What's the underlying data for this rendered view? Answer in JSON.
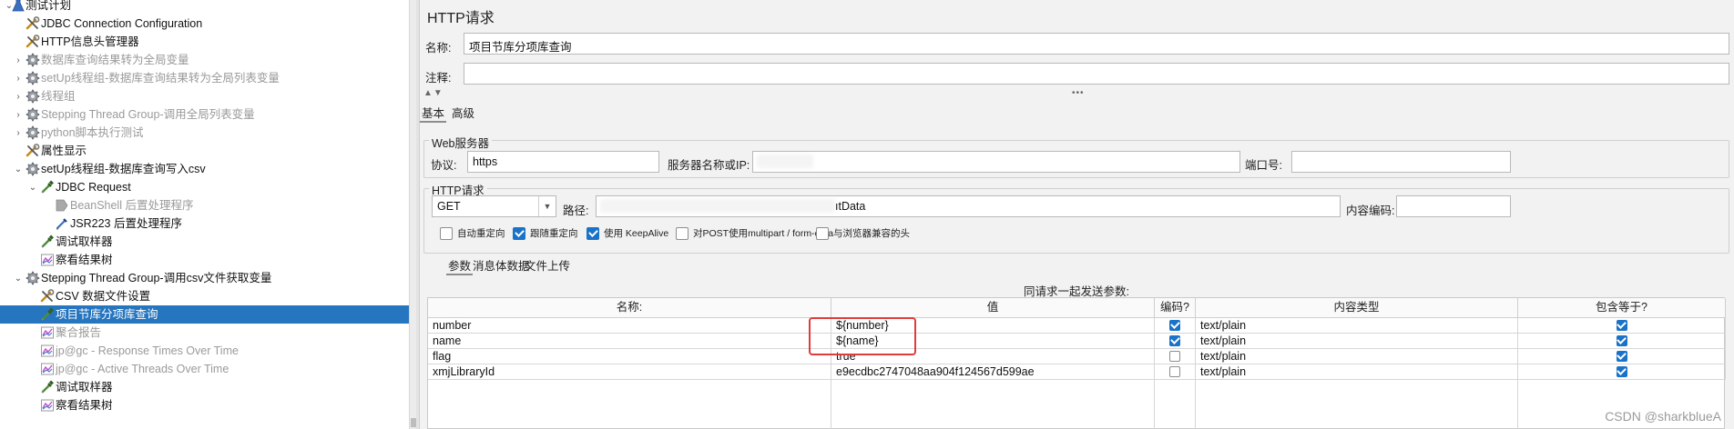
{
  "tree": {
    "items": [
      {
        "label": "测试计划",
        "icon": "test-plan-icon",
        "toggle": "expanded"
      },
      {
        "label": "JDBC Connection Configuration",
        "icon": "config-wrench-icon",
        "toggle": ""
      },
      {
        "label": "HTTP信息头管理器",
        "icon": "config-wrench-icon",
        "toggle": ""
      },
      {
        "label": "数据库查询结果转为全局变量",
        "icon": "thread-group-gear-icon",
        "toggle": "collapsed"
      },
      {
        "label": "setUp线程组-数据库查询结果转为全局列表变量",
        "icon": "thread-group-gear-icon",
        "toggle": "collapsed"
      },
      {
        "label": "线程组",
        "icon": "thread-group-gear-icon",
        "toggle": "collapsed"
      },
      {
        "label": "Stepping Thread Group-调用全局列表变量",
        "icon": "thread-group-gear-icon",
        "toggle": "collapsed"
      },
      {
        "label": "python脚本执行测试",
        "icon": "thread-group-gear-icon",
        "toggle": "collapsed"
      },
      {
        "label": "属性显示",
        "icon": "config-wrench-icon",
        "toggle": ""
      },
      {
        "label": "setUp线程组-数据库查询写入csv",
        "icon": "thread-group-gear-icon",
        "toggle": "expanded"
      },
      {
        "label": "JDBC Request",
        "icon": "sampler-pipette-icon",
        "toggle": "expanded"
      },
      {
        "label": "BeanShell 后置处理程序",
        "icon": "postprocessor-icon",
        "toggle": ""
      },
      {
        "label": "JSR223 后置处理程序",
        "icon": "script-icon",
        "toggle": ""
      },
      {
        "label": "调试取样器",
        "icon": "sampler-pipette-icon",
        "toggle": ""
      },
      {
        "label": "察看结果树",
        "icon": "listener-chart-icon",
        "toggle": ""
      },
      {
        "label": "Stepping Thread Group-调用csv文件获取变量",
        "icon": "thread-group-gear-icon",
        "toggle": "expanded"
      },
      {
        "label": "CSV 数据文件设置",
        "icon": "config-wrench-icon",
        "toggle": ""
      },
      {
        "label": "项目节库分项库查询",
        "icon": "sampler-pipette-icon",
        "toggle": ""
      },
      {
        "label": "聚合报告",
        "icon": "listener-chart-icon",
        "toggle": ""
      },
      {
        "label": "jp@gc - Response Times Over Time",
        "icon": "listener-chart-icon",
        "toggle": ""
      },
      {
        "label": "jp@gc - Active Threads Over Time",
        "icon": "listener-chart-icon",
        "toggle": ""
      },
      {
        "label": "调试取样器",
        "icon": "sampler-pipette-icon",
        "toggle": ""
      },
      {
        "label": "察看结果树",
        "icon": "listener-chart-icon",
        "toggle": ""
      }
    ]
  },
  "panel": {
    "title": "HTTP请求",
    "name_label": "名称:",
    "name_value": "项目节库分项库查询",
    "comment_label": "注释:",
    "comment_value": "",
    "splitter": "•••",
    "tabs": [
      "基本",
      "高级"
    ],
    "web_server": {
      "group_title": "Web服务器",
      "protocol_label": "协议:",
      "protocol_value": "https",
      "server_label": "服务器名称或IP:",
      "port_label": "端口号:",
      "port_value": ""
    },
    "http_request": {
      "group_title": "HTTP请求",
      "method": "GET",
      "path_label": "路径:",
      "path_visible_tail": "ıtData",
      "encoding_label": "内容编码:",
      "encoding_value": ""
    },
    "options": [
      {
        "label": "自动重定向",
        "checked": false
      },
      {
        "label": "跟随重定向",
        "checked": true
      },
      {
        "label": "使用 KeepAlive",
        "checked": true
      },
      {
        "label": "对POST使用multipart / form-data",
        "checked": false
      },
      {
        "label": "与浏览器兼容的头",
        "checked": false
      }
    ],
    "subtabs": [
      "参数",
      "消息体数据",
      "文件上传"
    ],
    "table_caption": "同请求一起发送参数:",
    "table": {
      "headers": [
        "名称:",
        "值",
        "编码?",
        "内容类型",
        "包含等于?"
      ],
      "rows": [
        {
          "name": "number",
          "value": "${number}",
          "encode": true,
          "content_type": "text/plain",
          "include_equals": true
        },
        {
          "name": "name",
          "value": "${name}",
          "encode": true,
          "content_type": "text/plain",
          "include_equals": true
        },
        {
          "name": "flag",
          "value": "true",
          "encode": false,
          "content_type": "text/plain",
          "include_equals": true
        },
        {
          "name": "xmjLibraryId",
          "value": "e9ecdbc2747048aa904f124567d599ae",
          "encode": false,
          "content_type": "text/plain",
          "include_equals": true
        }
      ]
    }
  },
  "watermark": "CSDN @sharkblueA"
}
